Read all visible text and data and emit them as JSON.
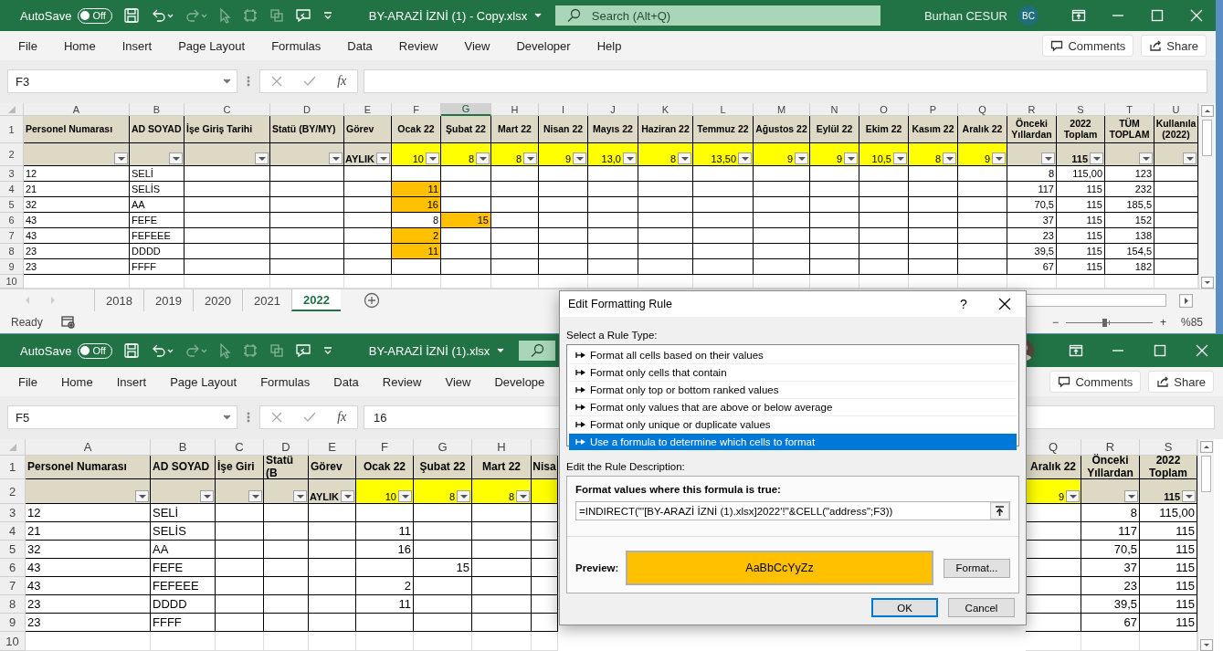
{
  "windows": [
    {
      "autosave": {
        "label": "AutoSave",
        "on": false,
        "state": "Off"
      },
      "title": "BY-ARAZİ İZNİ (1) - Copy.xlsx",
      "search": {
        "placeholder": "Search (Alt+Q)"
      },
      "user": {
        "name": "Burhan CESUR",
        "initials": "BC"
      },
      "menu": [
        "File",
        "Home",
        "Insert",
        "Page Layout",
        "Formulas",
        "Data",
        "Review",
        "View",
        "Developer",
        "Help"
      ],
      "comments": "Comments",
      "share": "Share",
      "name_box": "F3",
      "function_button": "fx",
      "grid": {
        "header_row": "1",
        "filter_row": "2",
        "columns": [
          {
            "letter": "A",
            "selected": false,
            "header": "Personel Numarası",
            "filter": {
              "color": "#ddd9c4"
            }
          },
          {
            "letter": "B",
            "selected": false,
            "header": "AD SOYAD",
            "filter": {
              "color": "#ddd9c4"
            }
          },
          {
            "letter": "C",
            "selected": false,
            "header": "İşe Giriş Tarihi",
            "filter": {
              "color": "#ddd9c4"
            }
          },
          {
            "letter": "D",
            "selected": false,
            "header": "Statü (BY/MY)",
            "filter": {
              "color": "#ddd9c4"
            }
          },
          {
            "letter": "E",
            "selected": false,
            "header": "Görev",
            "filter": {
              "value": "AYLIK",
              "color": "#ddd9c4"
            }
          },
          {
            "letter": "F",
            "selected": false,
            "header": "Ocak 22",
            "filter": {
              "value": "10",
              "color": "#ffff00"
            }
          },
          {
            "letter": "G",
            "selected": true,
            "header": "Şubat 22",
            "filter": {
              "value": "8",
              "color": "#ffff00"
            }
          },
          {
            "letter": "H",
            "selected": false,
            "header": "Mart 22",
            "filter": {
              "value": "8",
              "color": "#ffff00"
            }
          },
          {
            "letter": "I",
            "selected": false,
            "header": "Nisan 22",
            "filter": {
              "value": "9",
              "color": "#ffff00"
            }
          },
          {
            "letter": "J",
            "selected": false,
            "header": "Mayıs 22",
            "filter": {
              "value": "13,0",
              "color": "#ffff00"
            }
          },
          {
            "letter": "K",
            "selected": false,
            "header": "Haziran 22",
            "filter": {
              "value": "8",
              "color": "#ffff00"
            }
          },
          {
            "letter": "L",
            "selected": false,
            "header": "Temmuz 22",
            "filter": {
              "value": "13,50",
              "color": "#ffff00"
            }
          },
          {
            "letter": "M",
            "selected": false,
            "header": "Ağustos 22",
            "filter": {
              "value": "9",
              "color": "#ffff00"
            }
          },
          {
            "letter": "N",
            "selected": false,
            "header": "Eylül 22",
            "filter": {
              "value": "9",
              "color": "#ffff00"
            }
          },
          {
            "letter": "O",
            "selected": false,
            "header": "Ekim 22",
            "filter": {
              "value": "10,5",
              "color": "#ffff00"
            }
          },
          {
            "letter": "P",
            "selected": false,
            "header": "Kasım 22",
            "filter": {
              "value": "8",
              "color": "#ffff00"
            }
          },
          {
            "letter": "Q",
            "selected": false,
            "header": "Aralık 22",
            "filter": {
              "value": "9",
              "color": "#ffff00"
            }
          },
          {
            "letter": "R",
            "selected": false,
            "header": "Önceki Yıllardan",
            "filter": {
              "color": "#ddd9c4"
            }
          },
          {
            "letter": "S",
            "selected": false,
            "header": "2022 Toplam",
            "filter": {
              "value": "115",
              "color": "#ddd9c4"
            }
          },
          {
            "letter": "T",
            "selected": false,
            "header": "TÜM TOPLAM",
            "filter": {
              "color": "#ddd9c4"
            }
          },
          {
            "letter": "U",
            "selected": false,
            "header": "Kullanıla (2022)",
            "filter": {
              "color": "#ddd9c4"
            }
          }
        ],
        "rows": [
          {
            "number": "3",
            "cells": {
              "A": {
                "text": "12",
                "highlighted": false
              },
              "B": {
                "text": "SELİ",
                "highlighted": false
              },
              "R": {
                "text": "8",
                "highlighted": false
              },
              "S": {
                "text": "115,00",
                "highlighted": false
              },
              "T": {
                "text": "123",
                "highlighted": false
              }
            }
          },
          {
            "number": "4",
            "cells": {
              "A": {
                "text": "21",
                "highlighted": false
              },
              "B": {
                "text": "SELİS",
                "highlighted": false
              },
              "F": {
                "text": "11",
                "highlighted": true
              },
              "R": {
                "text": "117",
                "highlighted": false
              },
              "S": {
                "text": "115",
                "highlighted": false
              },
              "T": {
                "text": "232",
                "highlighted": false
              }
            }
          },
          {
            "number": "5",
            "cells": {
              "A": {
                "text": "32",
                "highlighted": false
              },
              "B": {
                "text": "AA",
                "highlighted": false
              },
              "F": {
                "text": "16",
                "highlighted": true
              },
              "R": {
                "text": "70,5",
                "highlighted": false
              },
              "S": {
                "text": "115",
                "highlighted": false
              },
              "T": {
                "text": "185,5",
                "highlighted": false
              }
            }
          },
          {
            "number": "6",
            "cells": {
              "A": {
                "text": "43",
                "highlighted": false
              },
              "B": {
                "text": "FEFE",
                "highlighted": false
              },
              "F": {
                "text": "8",
                "highlighted": false
              },
              "G": {
                "text": "15",
                "highlighted": true
              },
              "R": {
                "text": "37",
                "highlighted": false
              },
              "S": {
                "text": "115",
                "highlighted": false
              },
              "T": {
                "text": "152",
                "highlighted": false
              }
            }
          },
          {
            "number": "7",
            "cells": {
              "A": {
                "text": "43",
                "highlighted": false
              },
              "B": {
                "text": "FEFEEE",
                "highlighted": false
              },
              "F": {
                "text": "2",
                "highlighted": true
              },
              "R": {
                "text": "23",
                "highlighted": false
              },
              "S": {
                "text": "115",
                "highlighted": false
              },
              "T": {
                "text": "138",
                "highlighted": false
              }
            }
          },
          {
            "number": "8",
            "cells": {
              "A": {
                "text": "23",
                "highlighted": false
              },
              "B": {
                "text": "DDDD",
                "highlighted": false
              },
              "F": {
                "text": "11",
                "highlighted": true
              },
              "R": {
                "text": "39,5",
                "highlighted": false
              },
              "S": {
                "text": "115",
                "highlighted": false
              },
              "T": {
                "text": "154,5",
                "highlighted": false
              }
            }
          },
          {
            "number": "9",
            "cells": {
              "A": {
                "text": "23",
                "highlighted": false
              },
              "B": {
                "text": "FFFF",
                "highlighted": false
              },
              "R": {
                "text": "67",
                "highlighted": false
              },
              "S": {
                "text": "115",
                "highlighted": false
              },
              "T": {
                "text": "182",
                "highlighted": false
              }
            }
          },
          {
            "number": "10"
          }
        ]
      },
      "sheet_tabs": [
        {
          "label": "2018",
          "selected": false
        },
        {
          "label": "2019",
          "selected": false
        },
        {
          "label": "2020",
          "selected": false
        },
        {
          "label": "2021",
          "selected": false
        },
        {
          "label": "2022",
          "selected": true
        }
      ],
      "status": {
        "text": "Ready"
      },
      "zoom": {
        "minus": "−",
        "plus": "+",
        "level": 0.45,
        "reading": "%85"
      }
    },
    {
      "autosave": {
        "label": "AutoSave",
        "on": false,
        "state": "Off"
      },
      "title": "BY-ARAZİ İZNİ (1).xlsx",
      "avatar": {
        "kind": "picture"
      },
      "menu": [
        "File",
        "Home",
        "Insert",
        "Page Layout",
        "Formulas",
        "Data",
        "Review",
        "View",
        "Develope"
      ],
      "comments": "Comments",
      "share": "Share",
      "name_box": "F5",
      "function_button": "fx",
      "formula": "16",
      "grid": {
        "header_row": "1",
        "filter_row": "2",
        "columns": [
          {
            "letter": "A",
            "header": "Personel Numarası",
            "filter": {
              "color": "#ddd9c4"
            }
          },
          {
            "letter": "B",
            "header": "AD SOYAD",
            "filter": {
              "color": "#ddd9c4"
            }
          },
          {
            "letter": "C",
            "header": "İşe Giri",
            "filter": {
              "color": "#ddd9c4"
            }
          },
          {
            "letter": "D",
            "header": "Statü (B",
            "filter": {
              "color": "#ddd9c4"
            }
          },
          {
            "letter": "E",
            "header": "Görev",
            "filter": {
              "value": "AYLIK",
              "color": "#ddd9c4"
            }
          },
          {
            "letter": "F",
            "header": "Ocak 22",
            "filter": {
              "value": "10",
              "color": "#ffff00"
            }
          },
          {
            "letter": "G",
            "header": "Şubat 22",
            "filter": {
              "value": "8",
              "color": "#ffff00"
            }
          },
          {
            "letter": "H",
            "header": "Mart 22",
            "filter": {
              "value": "8",
              "color": "#ffff00"
            }
          },
          {
            "header": "Nisa",
            "filter": {
              "color": "#ffff00"
            }
          },
          {
            "letter": "Q",
            "header": "Aralık 22",
            "filter": {
              "value": "9",
              "color": "#ffff00"
            }
          },
          {
            "letter": "R",
            "header": "Önceki Yıllardan",
            "filter": {
              "color": "#ddd9c4"
            }
          },
          {
            "letter": "S",
            "header": "2022 Toplam",
            "filter": {
              "value": "115",
              "color": "#ddd9c4"
            }
          }
        ],
        "rows": [
          {
            "number": "3",
            "cells": {
              "A": {
                "text": "12"
              },
              "B": {
                "text": "SELİ"
              },
              "R": {
                "text": "8"
              },
              "S": {
                "text": "115,00"
              }
            }
          },
          {
            "number": "4",
            "cells": {
              "A": {
                "text": "21"
              },
              "B": {
                "text": "SELİS"
              },
              "F": {
                "text": "11"
              },
              "R": {
                "text": "117"
              },
              "S": {
                "text": "115"
              }
            }
          },
          {
            "number": "5",
            "cells": {
              "A": {
                "text": "32"
              },
              "B": {
                "text": "AA"
              },
              "F": {
                "text": "16"
              },
              "R": {
                "text": "70,5"
              },
              "S": {
                "text": "115"
              }
            }
          },
          {
            "number": "6",
            "cells": {
              "A": {
                "text": "43"
              },
              "B": {
                "text": "FEFE"
              },
              "G": {
                "text": "15"
              },
              "R": {
                "text": "37"
              },
              "S": {
                "text": "115"
              }
            }
          },
          {
            "number": "7",
            "cells": {
              "A": {
                "text": "43"
              },
              "B": {
                "text": "FEFEEE"
              },
              "F": {
                "text": "2"
              },
              "R": {
                "text": "23"
              },
              "S": {
                "text": "115"
              }
            }
          },
          {
            "number": "8",
            "cells": {
              "A": {
                "text": "23"
              },
              "B": {
                "text": "DDDD"
              },
              "F": {
                "text": "11"
              },
              "R": {
                "text": "39,5"
              },
              "S": {
                "text": "115"
              }
            }
          },
          {
            "number": "9",
            "cells": {
              "A": {
                "text": "23"
              },
              "B": {
                "text": "FFFF"
              },
              "R": {
                "text": "67"
              },
              "S": {
                "text": "115"
              }
            }
          },
          {
            "number": "10"
          }
        ]
      }
    }
  ],
  "dialog": {
    "title": "Edit Formatting Rule",
    "help": "?",
    "select_label": "Select a Rule Type:",
    "rule_types": [
      {
        "label": "Format all cells based on their values",
        "selected": false
      },
      {
        "label": "Format only cells that contain",
        "selected": false
      },
      {
        "label": "Format only top or bottom ranked values",
        "selected": false
      },
      {
        "label": "Format only values that are above or below average",
        "selected": false
      },
      {
        "label": "Format only unique or duplicate values",
        "selected": false
      },
      {
        "label": "Use a formula to determine which cells to format",
        "selected": true
      }
    ],
    "description_label": "Edit the Rule Description:",
    "formula_label": "Format values where this formula is true:",
    "formula": "=INDIRECT(\"'[BY-ARAZİ İZNİ (1).xlsx]2022'!\"&CELL(\"address\";F3))",
    "preview_label": "Preview:",
    "preview_sample": "AaBbCcYyZz",
    "format_button": "Format...",
    "ok": "OK",
    "cancel": "Cancel"
  }
}
